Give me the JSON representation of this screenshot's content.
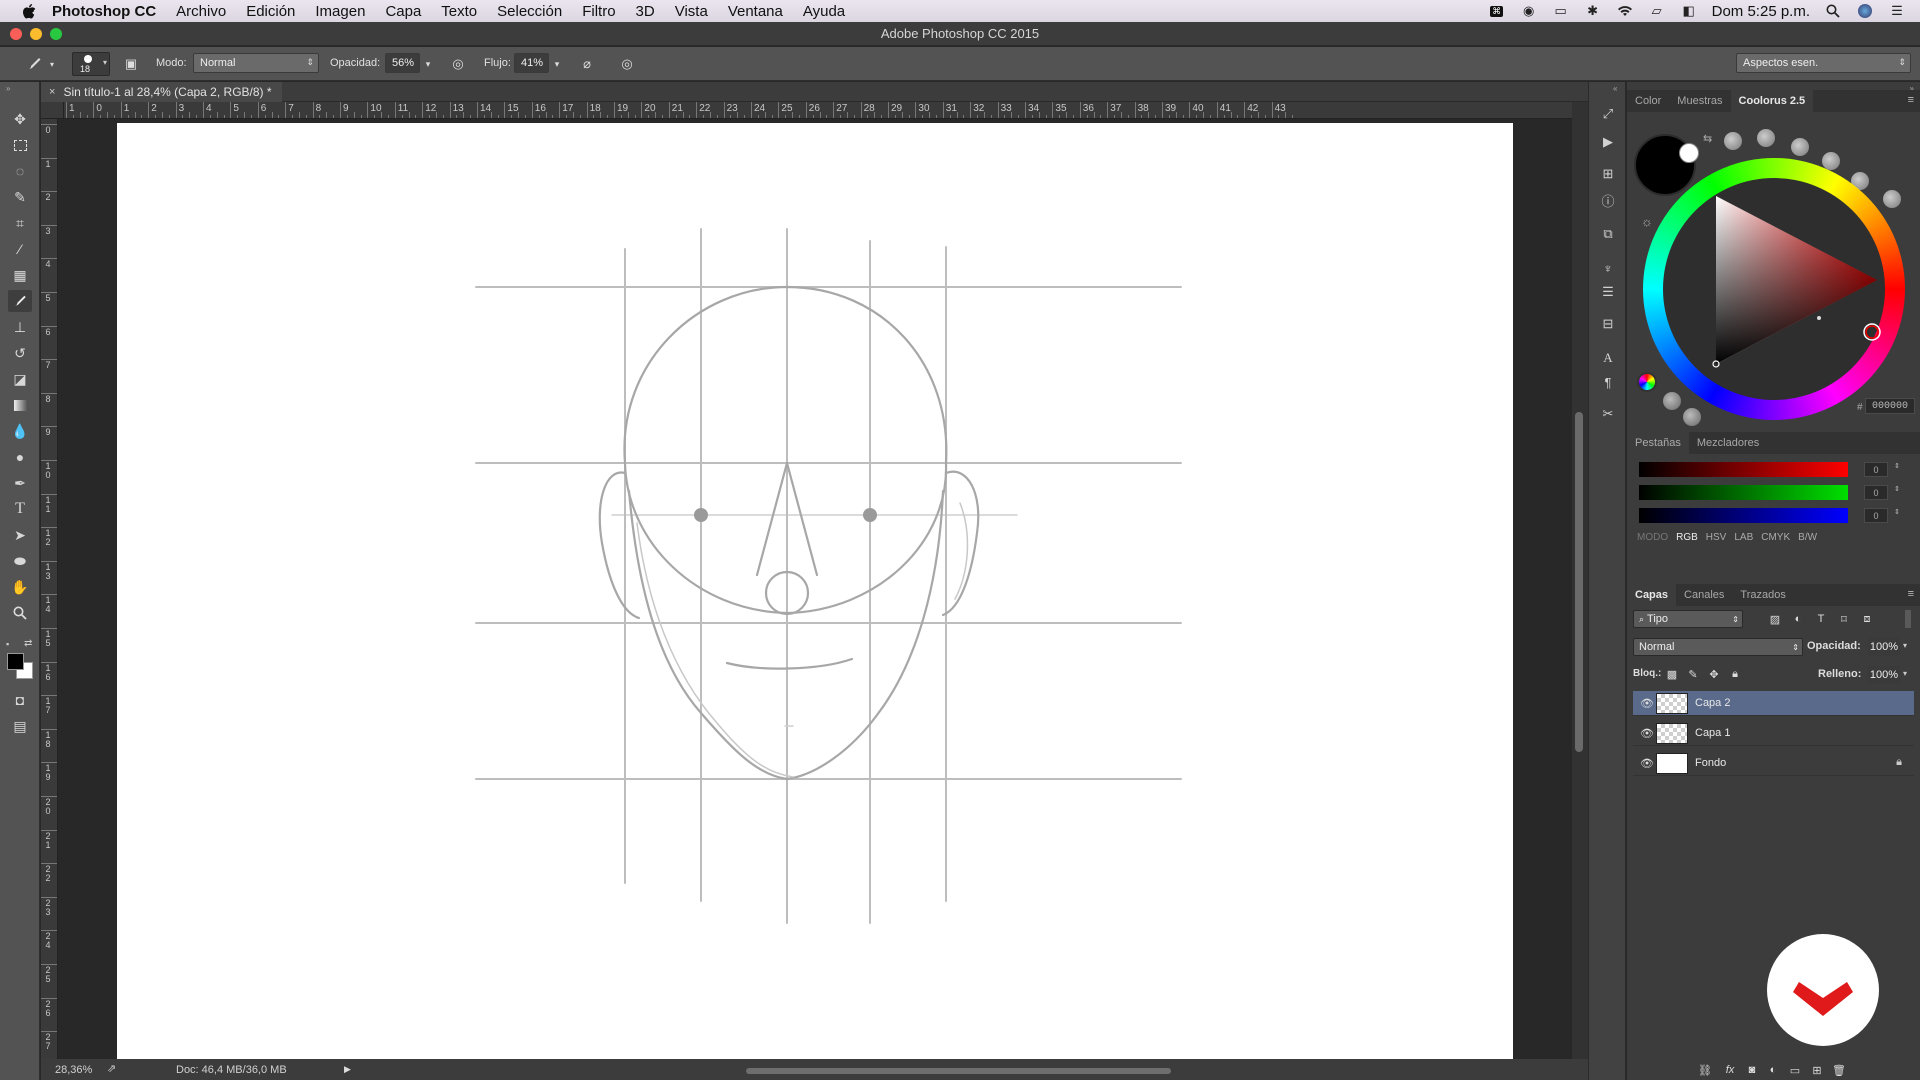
{
  "menubar": {
    "app_name": "Photoshop CC",
    "items": [
      "Archivo",
      "Edición",
      "Imagen",
      "Capa",
      "Texto",
      "Selección",
      "Filtro",
      "3D",
      "Vista",
      "Ventana",
      "Ayuda"
    ],
    "clock": "Dom 5:25 p.m."
  },
  "window": {
    "title": "Adobe Photoshop CC 2015"
  },
  "options": {
    "brush_size": "18",
    "mode_label": "Modo:",
    "mode_value": "Normal",
    "opacity_label": "Opacidad:",
    "opacity_value": "56%",
    "flow_label": "Flujo:",
    "flow_value": "41%",
    "workspace": "Aspectos esen."
  },
  "document": {
    "tab_title": "Sin título-1 al 28,4% (Capa 2, RGB/8) *",
    "close_glyph": "×",
    "ruler_h": [
      "1",
      "0",
      "1",
      "2",
      "3",
      "4",
      "5",
      "6",
      "7",
      "8",
      "9",
      "10",
      "11",
      "12",
      "13",
      "14",
      "15",
      "16",
      "17",
      "18",
      "19",
      "20",
      "21",
      "22",
      "23",
      "24",
      "25",
      "26",
      "27",
      "28",
      "29",
      "30",
      "31",
      "32",
      "33",
      "34",
      "35",
      "36",
      "37",
      "38",
      "39",
      "40",
      "41",
      "42",
      "43"
    ],
    "ruler_v": [
      "0",
      "1",
      "2",
      "3",
      "4",
      "5",
      "6",
      "7",
      "8",
      "9",
      "10",
      "11",
      "12",
      "13",
      "14",
      "15",
      "16",
      "17",
      "18",
      "19",
      "20",
      "21",
      "22",
      "23",
      "24",
      "25",
      "26",
      "27"
    ]
  },
  "status": {
    "zoom": "28,36%",
    "doc": "Doc: 46,4 MB/36,0 MB"
  },
  "color_panel": {
    "tabs": [
      "Color",
      "Muestras",
      "Coolorus 2.5"
    ],
    "hex_symbol": "#",
    "hex": "000000",
    "fg_color": "#000000",
    "bg_color": "#ffffff",
    "subtabs": [
      "Pestañas",
      "Mezcladores"
    ],
    "channels": [
      {
        "name": "R",
        "value": "0",
        "color": "#ff0000"
      },
      {
        "name": "G",
        "value": "0",
        "color": "#00e000"
      },
      {
        "name": "B",
        "value": "0",
        "color": "#0000ff"
      }
    ],
    "modes_label": "MODO",
    "modes": [
      "RGB",
      "HSV",
      "LAB",
      "CMYK",
      "B/W"
    ]
  },
  "layers_panel": {
    "tabs": [
      "Capas",
      "Canales",
      "Trazados"
    ],
    "filter": "Tipo",
    "blend": "Normal",
    "opacity_label": "Opacidad:",
    "opacity": "100%",
    "lock_label": "Bloq.:",
    "fill_label": "Relleno:",
    "fill": "100%",
    "layers": [
      {
        "name": "Capa 2",
        "active": true
      },
      {
        "name": "Capa 1",
        "active": false
      },
      {
        "name": "Fondo",
        "active": false
      }
    ]
  }
}
